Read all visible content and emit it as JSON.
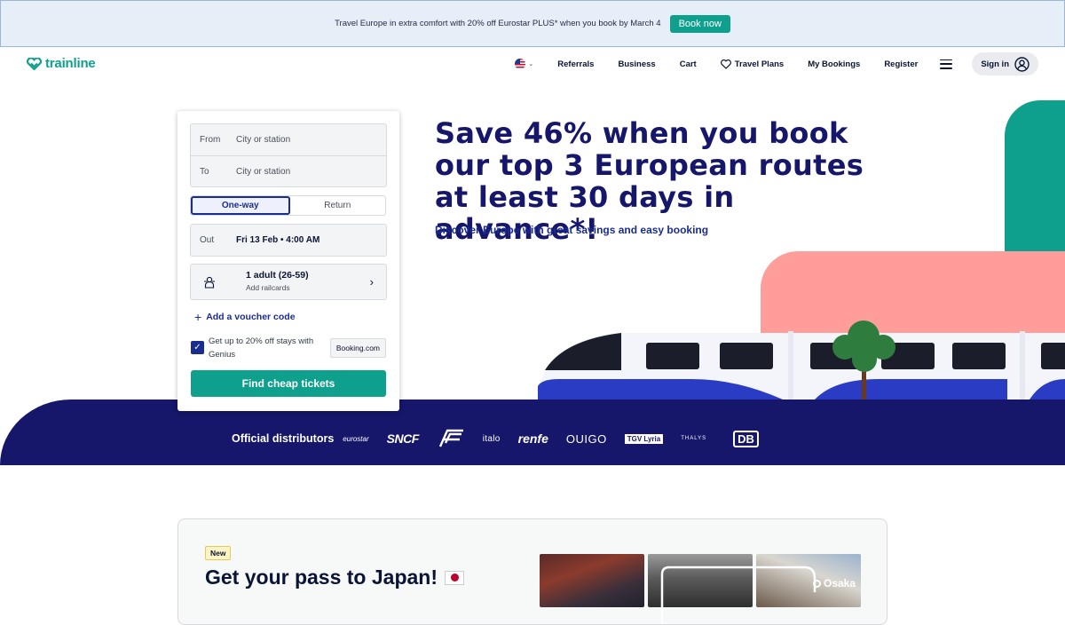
{
  "promo": {
    "text": "Travel Europe in extra comfort with 20% off Eurostar PLUS* when you book by March 4",
    "button": "Book now"
  },
  "header": {
    "logo": "trainline",
    "nav": {
      "referrals": "Referrals",
      "business": "Business",
      "cart": "Cart",
      "travel_plans": "Travel Plans",
      "my_bookings": "My Bookings",
      "register": "Register",
      "sign_in": "Sign in"
    }
  },
  "search": {
    "from_label": "From",
    "from_placeholder": "City or station",
    "to_label": "To",
    "to_placeholder": "City or station",
    "trip_types": [
      "One-way",
      "Return"
    ],
    "selected_trip_type": "One-way",
    "out_label": "Out",
    "out_value": "Fri 13 Feb • 4:00 AM",
    "passengers": "1 adult (26-59)",
    "railcards": "Add railcards",
    "voucher": "Add a voucher code",
    "genius_text": "Get up to 20% off stays with Genius",
    "genius_checked": true,
    "genius_partner": "Booking.com",
    "submit": "Find cheap tickets"
  },
  "hero": {
    "headline": "Save 46% when you book our top 3 European routes at least 30 days in advance*!",
    "subhead": "Discover Europe with great savings and easy booking"
  },
  "distributors": {
    "title": "Official distributors",
    "logos": [
      "eurostar",
      "SNCF",
      "italo",
      "renfe",
      "OUIGO",
      "TGV Lyria",
      "THALYS",
      "DB"
    ]
  },
  "japan": {
    "badge": "New",
    "title": "Get your pass to Japan!",
    "city": "Osaka"
  },
  "colors": {
    "brand_green": "#0fa08d",
    "navy": "#16166b",
    "pink": "#ff9d9b",
    "accent_blue": "#1a2d8f"
  }
}
